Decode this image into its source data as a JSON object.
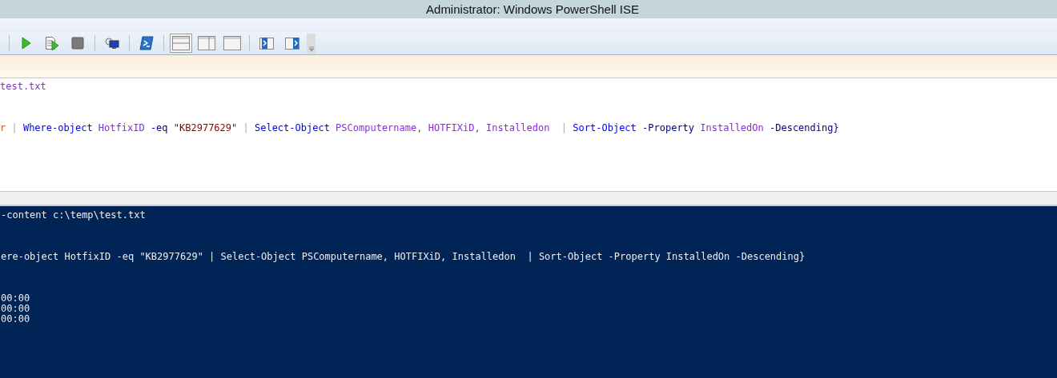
{
  "window": {
    "title": "Administrator: Windows PowerShell ISE"
  },
  "toolbar": [
    {
      "kind": "separator"
    },
    {
      "kind": "run"
    },
    {
      "kind": "run-selection"
    },
    {
      "kind": "stop"
    },
    {
      "kind": "separator"
    },
    {
      "kind": "remote"
    },
    {
      "kind": "separator"
    },
    {
      "kind": "powershell"
    },
    {
      "kind": "separator"
    },
    {
      "kind": "layout-top",
      "selected": true
    },
    {
      "kind": "layout-right",
      "selected": false
    },
    {
      "kind": "layout-max",
      "selected": false
    },
    {
      "kind": "separator"
    },
    {
      "kind": "snippet-left"
    },
    {
      "kind": "snippet-right"
    },
    {
      "kind": "overflow"
    }
  ],
  "script_pane": {
    "blocks": [
      [
        [
          {
            "text": "test.txt",
            "kind": "member"
          }
        ]
      ],
      [
        [
          {
            "text": "r",
            "kind": "variable"
          },
          {
            "text": " | ",
            "kind": "operator"
          },
          {
            "text": "Where-object",
            "kind": "command"
          },
          {
            "text": " HotfixID",
            "kind": "member"
          },
          {
            "text": " -eq",
            "kind": "parameter"
          },
          {
            "text": " \"KB2977629\"",
            "kind": "string"
          },
          {
            "text": " | ",
            "kind": "operator"
          },
          {
            "text": "Select-Object",
            "kind": "command"
          },
          {
            "text": " PSComputername, HOTFIXiD, Installedon",
            "kind": "member"
          },
          {
            "text": "  | ",
            "kind": "operator"
          },
          {
            "text": "Sort-Object",
            "kind": "command"
          },
          {
            "text": " -Property",
            "kind": "parameter"
          },
          {
            "text": " InstalledOn",
            "kind": "member"
          },
          {
            "text": " -Descending}",
            "kind": "parameter"
          }
        ]
      ]
    ]
  },
  "console": {
    "blocks": [
      [
        "-content c:\\temp\\test.txt"
      ],
      [
        "ere-object HotfixID -eq \"KB2977629\" | Select-Object PSComputername, HOTFIXiD, Installedon  | Sort-Object -Property InstalledOn -Descending}"
      ],
      [
        "00:00",
        "00:00",
        "00:00"
      ]
    ]
  }
}
